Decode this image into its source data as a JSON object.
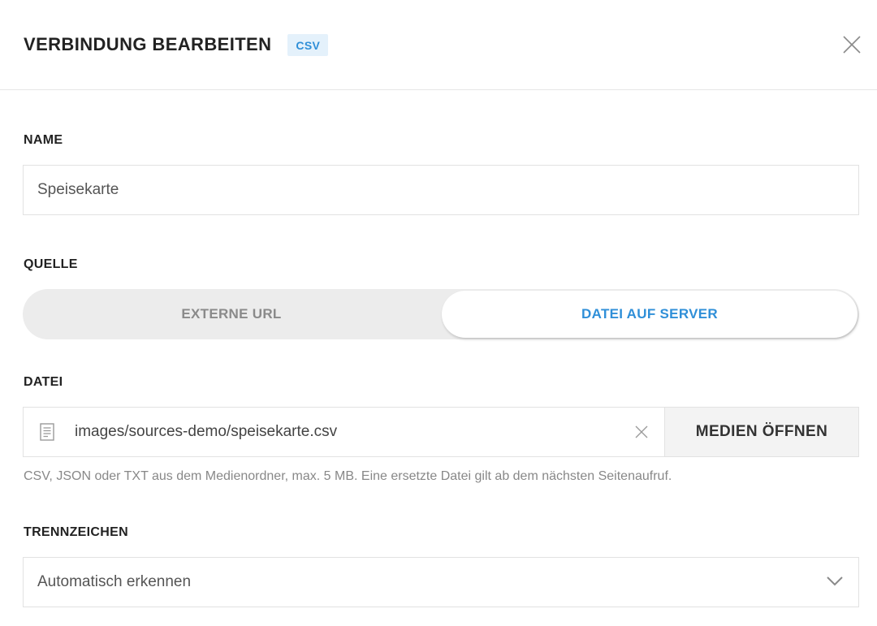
{
  "header": {
    "title": "VERBINDUNG BEARBEITEN",
    "badge": "CSV",
    "close_icon": "close-icon"
  },
  "fields": {
    "name": {
      "label": "NAME",
      "value": "Speisekarte"
    },
    "source": {
      "label": "QUELLE",
      "options": [
        "EXTERNE URL",
        "DATEI AUF SERVER"
      ],
      "selected": "DATEI AUF SERVER"
    },
    "file": {
      "label": "DATEI",
      "icon": "file-icon",
      "value": "images/sources-demo/speisekarte.csv",
      "clear_icon": "clear-icon",
      "button_label": "MEDIEN ÖFFNEN",
      "hint": "CSV, JSON oder TXT aus dem Medienordner, max. 5 MB. Eine ersetzte Datei gilt ab dem nächsten Seitenaufruf."
    },
    "separator": {
      "label": "TRENNZEICHEN",
      "value": "Automatisch erkennen",
      "icon": "chevron-down-icon"
    }
  },
  "colors": {
    "accent": "#2f8fd8",
    "badge_bg": "#e4f1fb",
    "toggle_bg": "#ececec",
    "border": "#e2e2e2"
  }
}
